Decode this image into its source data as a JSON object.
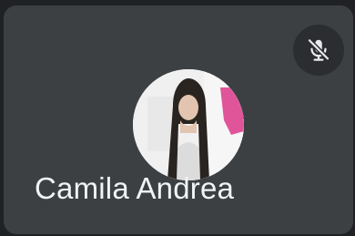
{
  "participant": {
    "name": "Camila Andrea",
    "status_icon": "microphone-off-icon"
  },
  "colors": {
    "tile_background": "#3c4043",
    "page_background": "#202124",
    "mute_button_background": "#2b2d30",
    "name_text": "#f1f3f4"
  }
}
